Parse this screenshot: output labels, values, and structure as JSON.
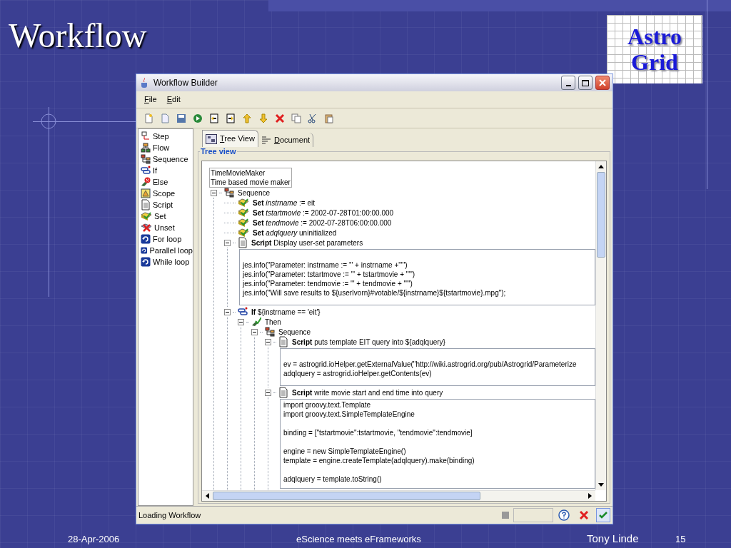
{
  "slide": {
    "title": "Workflow",
    "logo": [
      "Astro",
      "Grid"
    ],
    "footer": {
      "date": "28-Apr-2006",
      "center": "eScience meets eFrameworks",
      "author": "Tony Linde",
      "page": "15"
    }
  },
  "window": {
    "title": "Workflow Builder"
  },
  "menu": [
    "File",
    "Edit"
  ],
  "palette": [
    {
      "label": "Step",
      "kind": "step"
    },
    {
      "label": "Flow",
      "kind": "flow"
    },
    {
      "label": "Sequence",
      "kind": "sequence"
    },
    {
      "label": "If",
      "kind": "if"
    },
    {
      "label": "Else",
      "kind": "else"
    },
    {
      "label": "Scope",
      "kind": "scope"
    },
    {
      "label": "Script",
      "kind": "script"
    },
    {
      "label": "Set",
      "kind": "set"
    },
    {
      "label": "Unset",
      "kind": "unset"
    },
    {
      "label": "For loop",
      "kind": "loop"
    },
    {
      "label": "Parallel loop",
      "kind": "loop"
    },
    {
      "label": "While loop",
      "kind": "loop"
    }
  ],
  "tabs": [
    {
      "label": "Tree View",
      "selected": true
    },
    {
      "label": "Document",
      "selected": false
    }
  ],
  "group_title": "Tree view",
  "tree": {
    "header": [
      "TimeMovieMaker",
      "Time based movie maker"
    ],
    "nodes": [
      {
        "kind": "sequence",
        "label": "Sequence",
        "expanded": true,
        "children": [
          {
            "kind": "set",
            "keyword": "Set",
            "variable": "instrname",
            "text": ":= eit"
          },
          {
            "kind": "set",
            "keyword": "Set",
            "variable": "tstartmovie",
            "text": ":= 2002-07-28T01:00:00.000"
          },
          {
            "kind": "set",
            "keyword": "Set",
            "variable": "tendmovie",
            "text": ":= 2002-07-28T06:00:00.000"
          },
          {
            "kind": "set",
            "keyword": "Set",
            "variable": "adqlquery",
            "text": "uninitialized"
          },
          {
            "kind": "script",
            "keyword": "Script",
            "text": "Display user-set parameters",
            "expanded": true,
            "code": [
              [
                "jes.info(\"Parameter: instrname := '\" + instrname +\"'\")",
                "jes.info(\"Parameter: tstartmove := '\" + tstartmovie + \"'\")",
                "jes.info(\"Parameter: tendmovie := '\" + tendmovie + \"'\")",
                "jes.info(\"Will save results to ${userIvorn}#votable/${instrname}${tstartmovie}.mpg\");"
              ]
            ]
          },
          {
            "kind": "if",
            "keyword": "If",
            "text": "${instrname == 'eit'}",
            "expanded": true,
            "children": [
              {
                "kind": "then",
                "label": "Then",
                "expanded": true,
                "children": [
                  {
                    "kind": "sequence",
                    "label": "Sequence",
                    "expanded": true,
                    "children": [
                      {
                        "kind": "script",
                        "keyword": "Script",
                        "text": "puts template EIT query into ${adqlquery}",
                        "expanded": true,
                        "code": [
                          [
                            "ev = astrogrid.ioHelper.getExternalValue(\"http://wiki.astrogrid.org/pub/Astrogrid/Parameterize",
                            "adqlquery = astrogrid.ioHelper.getContents(ev)"
                          ]
                        ]
                      },
                      {
                        "kind": "script",
                        "keyword": "Script",
                        "text": "write movie start and end time into query",
                        "expanded": true,
                        "code": [
                          [
                            "import groovy.text.Template",
                            "import groovy.text.SimpleTemplateEngine"
                          ],
                          [
                            "binding = [\"tstartmovie\":tstartmovie, \"tendmovie\":tendmovie]"
                          ],
                          [
                            "engine = new SimpleTemplateEngine()",
                            "template = engine.createTemplate(adqlquery).make(binding)"
                          ],
                          [
                            "adqlquery = template.toString()"
                          ]
                        ]
                      }
                    ]
                  }
                ]
              }
            ]
          }
        ]
      }
    ]
  },
  "status_bar": {
    "text": "Loading Workflow"
  }
}
